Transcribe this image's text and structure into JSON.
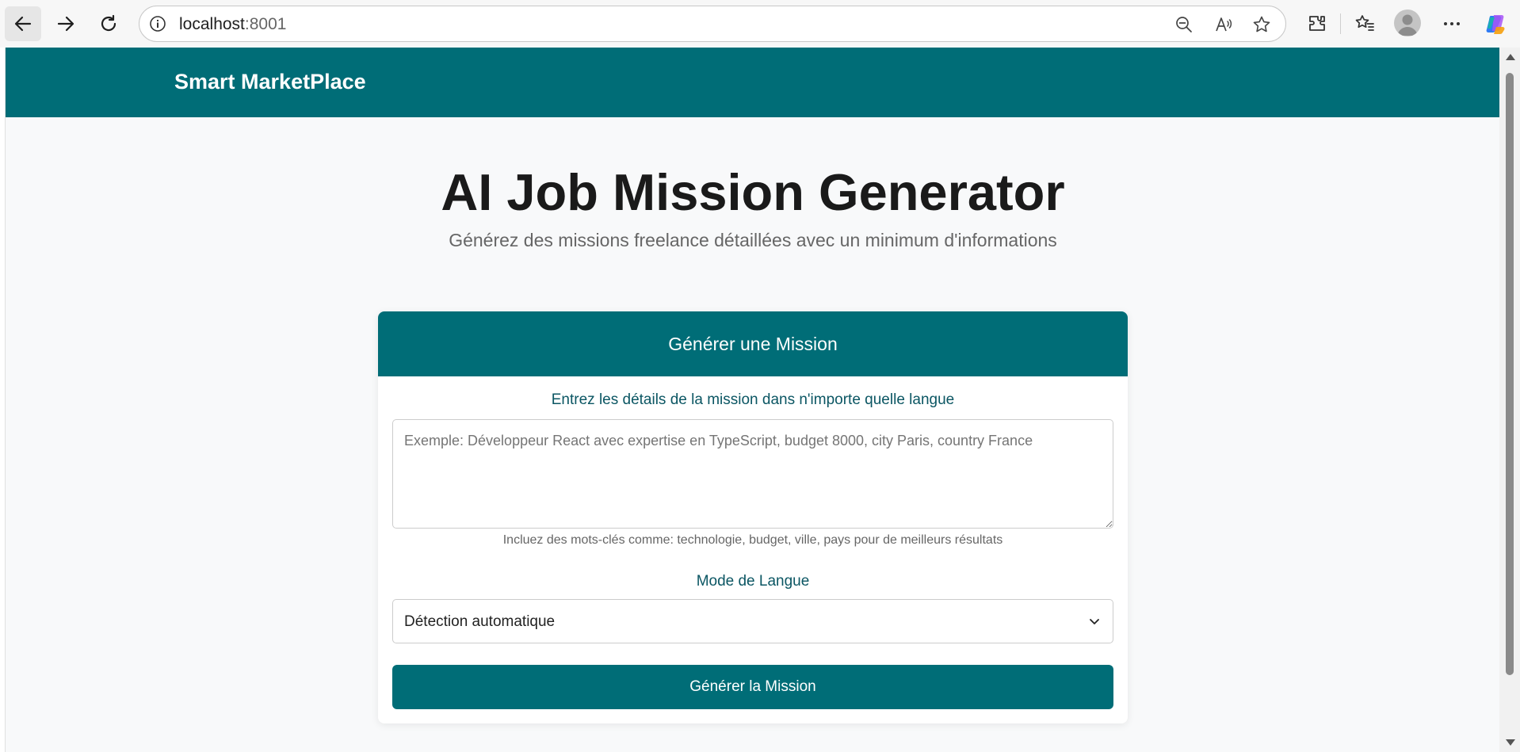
{
  "browser": {
    "address_host": "localhost",
    "address_port": ":8001"
  },
  "app": {
    "brand": "Smart MarketPlace"
  },
  "hero": {
    "title": "AI Job Mission Generator",
    "subtitle": "Générez des missions freelance détaillées avec un minimum d'informations"
  },
  "card": {
    "title": "Générer une Mission",
    "details_label": "Entrez les détails de la mission dans n'importe quelle langue",
    "details_placeholder": "Exemple: Développeur React avec expertise en TypeScript, budget 8000, city Paris, country France",
    "details_value": "",
    "hint": "Incluez des mots-clés comme: technologie, budget, ville, pays pour de meilleurs résultats",
    "language_label": "Mode de Langue",
    "language_selected": "Détection automatique",
    "submit_label": "Générer la Mission"
  },
  "colors": {
    "brand": "#006d77",
    "label": "#0b5663",
    "background": "#f8f9fa"
  }
}
